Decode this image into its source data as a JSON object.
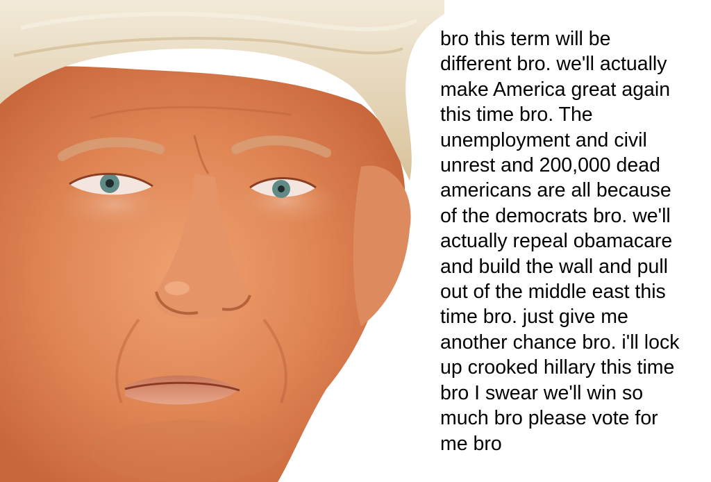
{
  "caption": {
    "lines": [
      "bro this term will be",
      "different bro. we'll actually",
      "make America great again",
      "this time bro. The",
      "unemployment and civil",
      "unrest and 200,000 dead",
      "americans are all because",
      "of the democrats bro. we'll",
      "actually repeal obamacare",
      "and build the wall and pull",
      "out of the middle east this",
      "time bro. just give me",
      "another chance bro. i'll lock",
      "up crooked hillary this time",
      "bro I swear we'll win so",
      "much bro please vote for",
      "me bro"
    ]
  },
  "colors": {
    "background": "#ffffff",
    "text": "#000000",
    "skin": "#e08a5a",
    "hair": "#e9dcc4"
  }
}
